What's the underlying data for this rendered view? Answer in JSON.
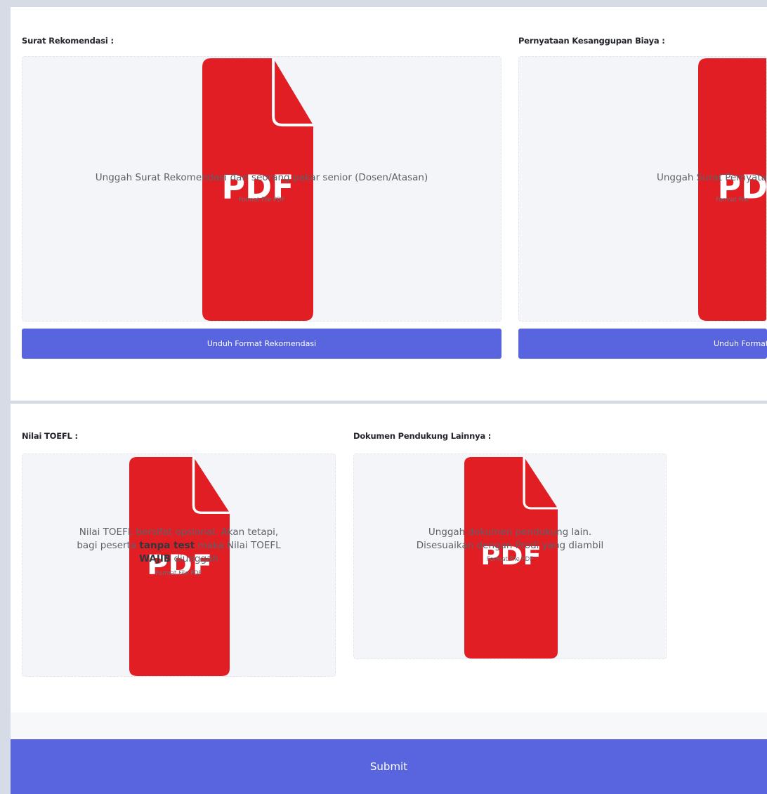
{
  "sections": {
    "rekomendasi": {
      "label": "Surat Rekomendasi :",
      "upload_text": "Unggah Surat Rekomendasi dari seorang pakar senior (Dosen/Atasan)",
      "format_hint": "Format File PDF",
      "button": "Unduh Format Rekomendasi"
    },
    "biaya": {
      "label": "Pernyataan Kesanggupan Biaya :",
      "upload_text": "Unggah Surat Pernyataan",
      "format_hint": "Format File",
      "button": "Unduh Format P"
    },
    "toefl": {
      "label": "Nilai TOEFL :",
      "text_1": "Nilai TOEFL bersifat opsional. Akan tetapi, bagi peserta ",
      "text_bold_1": "tanpa test",
      "text_2": " maka Nilai TOEFL ",
      "text_bold_2": "WAJIB",
      "text_3": " diunggah",
      "format_hint": "Format File PDF"
    },
    "pendukung": {
      "label": "Dokumen Pendukung Lainnya :",
      "upload_text": "Unggah dokumen pendukung lain. Disesuaikan dengan Prodi yang diambil",
      "format_hint": "Format File PDF"
    }
  },
  "submit": {
    "label": "Submit"
  },
  "icon": {
    "name": "pdf-file-icon",
    "text": "PDF"
  },
  "colors": {
    "primary": "#5865df",
    "pdf_red": "#e01e24",
    "dropzone_bg": "#f4f5f8",
    "page_bg": "#d5dce6"
  }
}
